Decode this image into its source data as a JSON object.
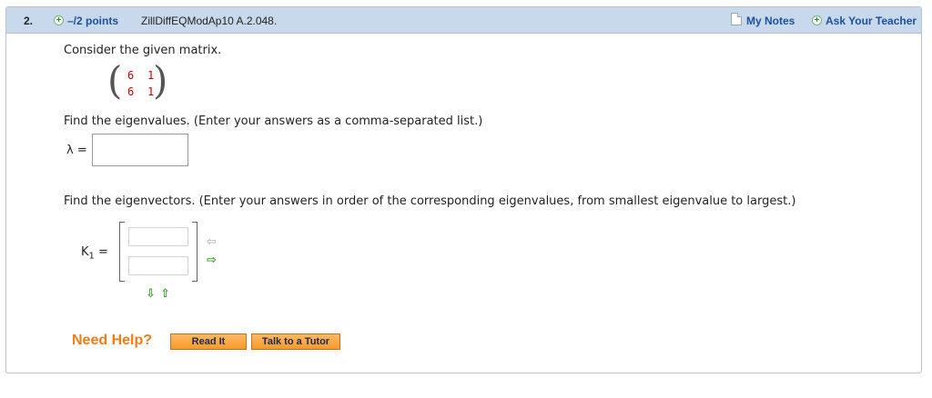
{
  "question": {
    "number": "2.",
    "points": "–/2 points",
    "code": "ZillDiffEQModAp10 A.2.048.",
    "my_notes": "My Notes",
    "ask_teacher": "Ask Your Teacher"
  },
  "body": {
    "intro": "Consider the given matrix.",
    "matrix": [
      [
        "6",
        "1"
      ],
      [
        "6",
        "1"
      ]
    ],
    "eigenvalues_prompt": "Find the eigenvalues. (Enter your answers as a comma-separated list.)",
    "lambda_label": "λ =",
    "lambda_value": "",
    "eigenvectors_prompt": "Find the eigenvectors. (Enter your answers in order of the corresponding eigenvalues, from smallest eigenvalue to largest.)",
    "k1_label": "K",
    "k1_subscript": "1",
    "k1_equals": "=",
    "k1_values": [
      "",
      ""
    ]
  },
  "help": {
    "need_help": "Need Help?",
    "read_it": "Read It",
    "talk_tutor": "Talk to a Tutor"
  },
  "icons": {
    "add_row_arrow": "arrow-down-icon",
    "remove_row_arrow": "arrow-up-icon",
    "add_col_arrow": "arrow-right-icon",
    "remove_col_arrow": "arrow-left-icon"
  },
  "colors": {
    "header_bg": "#c9d9ec",
    "link_blue": "#1c4f9c",
    "matrix_red": "#cc0000",
    "help_orange": "#f07d17",
    "arrow_green": "#3a9a2a",
    "arrow_disabled": "#b8b8b8"
  }
}
